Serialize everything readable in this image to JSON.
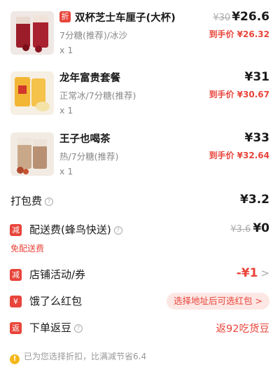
{
  "items": [
    {
      "discount_badge": "折",
      "name": "双杯芝士车厘子(大杯)",
      "spec": "7分糖(推荐)/冰沙",
      "qty": "x 1",
      "orig_price": "¥30",
      "price": "¥26.6",
      "final_price": "到手价 ¥26.32"
    },
    {
      "name": "龙年富贵套餐",
      "spec": "正常冰/7分糖(推荐)",
      "qty": "x 1",
      "price": "¥31",
      "final_price": "到手价 ¥30.67"
    },
    {
      "name": "王子也喝茶",
      "spec": "热/7分糖(推荐)",
      "qty": "x 1",
      "price": "¥33",
      "final_price": "到手价 ¥32.64"
    }
  ],
  "packing": {
    "label": "打包费",
    "value": "¥3.2"
  },
  "delivery": {
    "icon_text": "减",
    "label": "配送费(蜂鸟快送)",
    "orig": "¥3.6",
    "value": "¥0",
    "note": "免配送费"
  },
  "store_promo": {
    "icon_text": "减",
    "label": "店铺活动/券",
    "value": "-¥1"
  },
  "red_packet": {
    "icon_text": "¥",
    "label": "饿了么红包",
    "button": "选择地址后可选红包 >"
  },
  "beans": {
    "icon_text": "返",
    "label": "下单返豆",
    "value": "返92吃货豆"
  },
  "footer": {
    "icon_text": "!",
    "text": "已为您选择折扣，比满减节省6.4"
  },
  "colors": {
    "accent": "#e8443a",
    "pill_bg": "#fde7e4",
    "info": "#f5b71a"
  }
}
